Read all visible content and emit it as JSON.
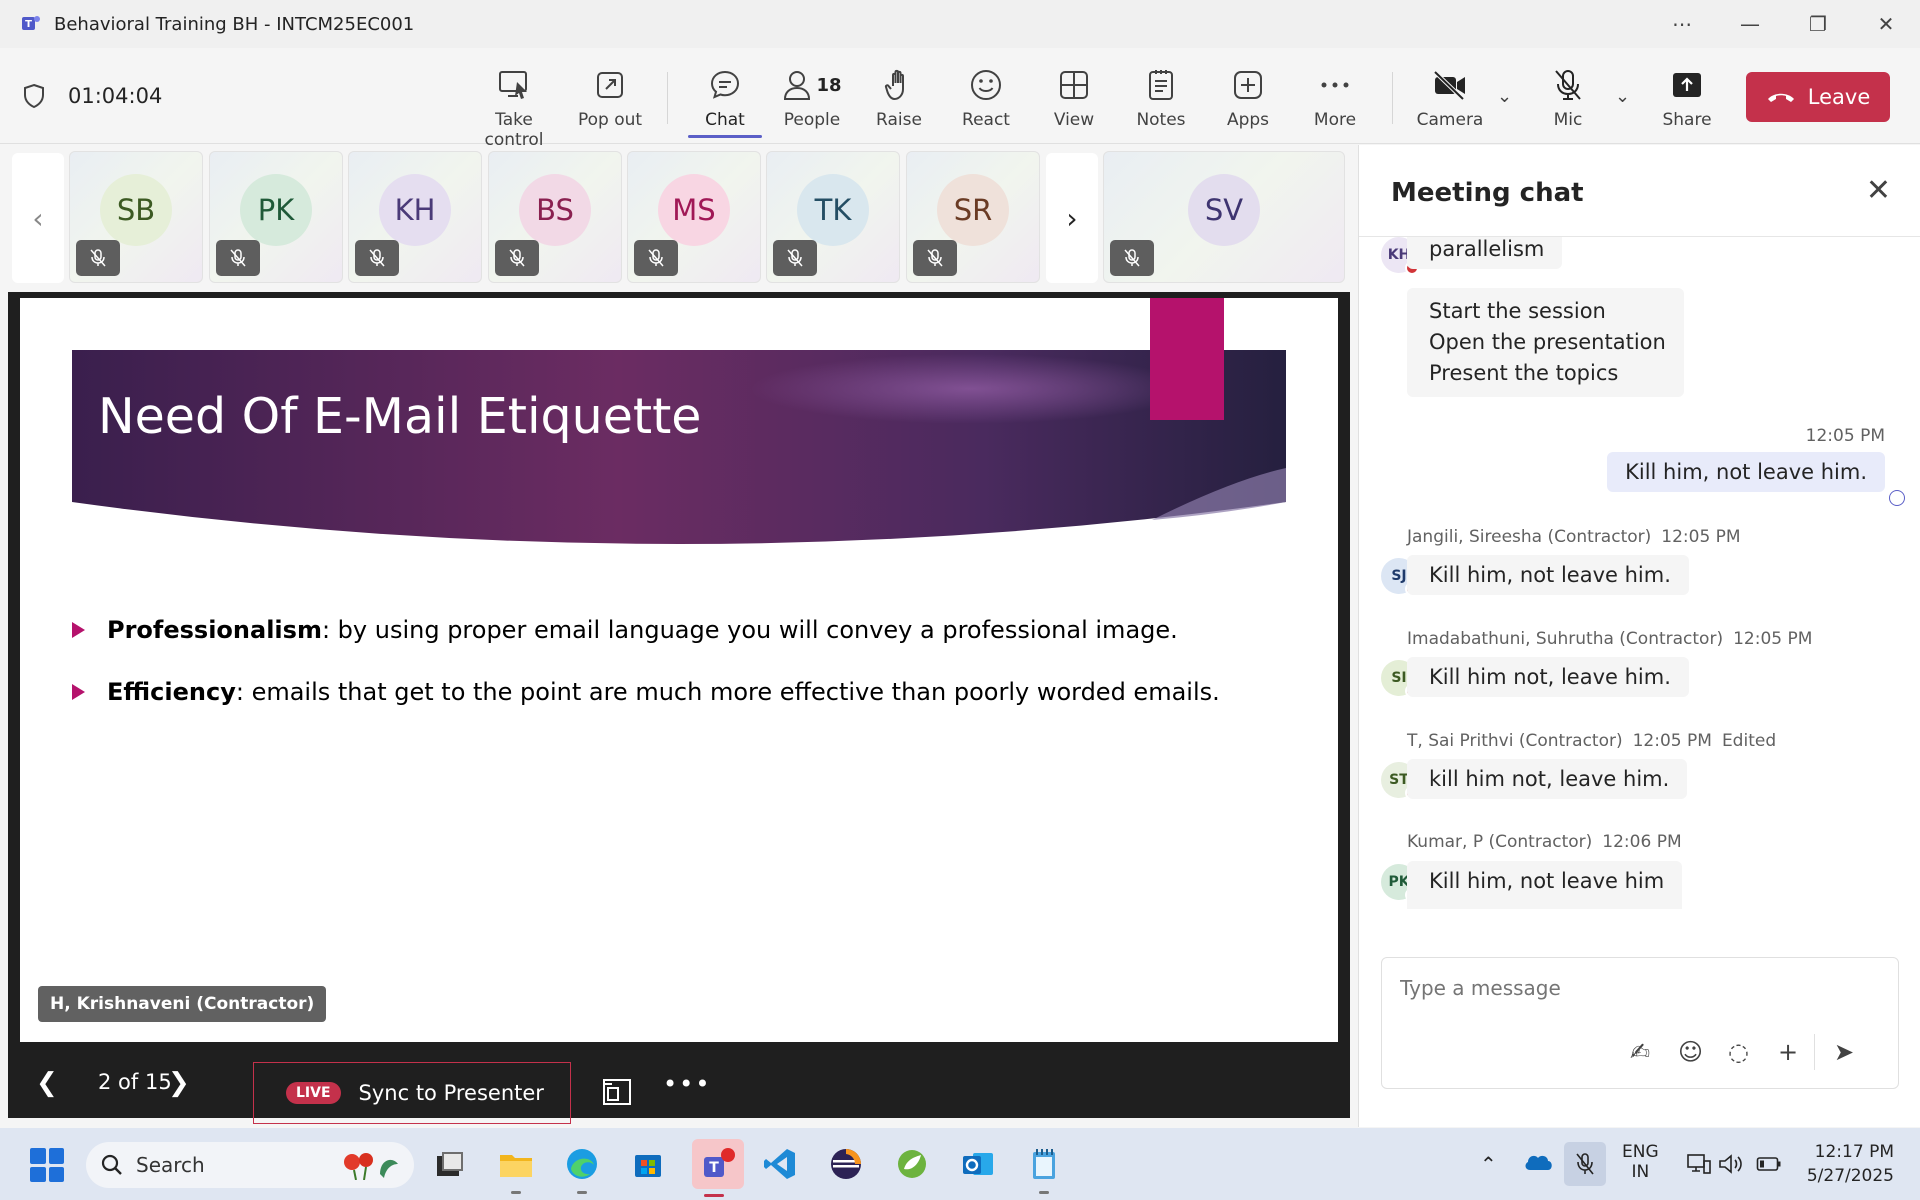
{
  "window": {
    "title": "Behavioral Training BH - INTCM25EC001"
  },
  "toolbar": {
    "timer": "01:04:04",
    "take_control": "Take control",
    "pop_out": "Pop out",
    "chat": "Chat",
    "people": "People",
    "people_count": "18",
    "raise": "Raise",
    "react": "React",
    "view": "View",
    "notes": "Notes",
    "apps": "Apps",
    "more": "More",
    "camera": "Camera",
    "mic": "Mic",
    "share": "Share",
    "leave": "Leave"
  },
  "participants": [
    {
      "initials": "SB",
      "bg": "#e6efd8",
      "fg": "#3c5a22"
    },
    {
      "initials": "PK",
      "bg": "#d6eadc",
      "fg": "#1f5a38"
    },
    {
      "initials": "KH",
      "bg": "#e5def0",
      "fg": "#4a3a78"
    },
    {
      "initials": "BS",
      "bg": "#f2d9e6",
      "fg": "#8a2050"
    },
    {
      "initials": "MS",
      "bg": "#f8d6e3",
      "fg": "#a01856"
    },
    {
      "initials": "TK",
      "bg": "#d9e7ee",
      "fg": "#244e64"
    },
    {
      "initials": "SR",
      "bg": "#efe1da",
      "fg": "#6a3b24"
    },
    {
      "initials": "SV",
      "bg": "#e3ddee",
      "fg": "#3e3470"
    }
  ],
  "slide": {
    "title": "Need Of E-Mail Etiquette",
    "bullets": [
      {
        "term": "Professionalism",
        "text": ": by using proper email language you will convey a professional image."
      },
      {
        "term": "Efficiency",
        "text": ": emails that get to the point are much more effective than poorly worded emails."
      }
    ],
    "presenter": "H, Krishnaveni (Contractor)",
    "page": "2 of 15",
    "live": "LIVE",
    "sync": "Sync to Presenter"
  },
  "chat": {
    "title": "Meeting chat",
    "messages": {
      "kh": {
        "initials": "KH",
        "text": "parallelism"
      },
      "kh_list": [
        "Start the session",
        "Open the presentation",
        "Present the topics"
      ],
      "mine_time": "12:05 PM",
      "mine_text": "Kill him, not leave him.",
      "sj": {
        "initials": "SJ",
        "name": "Jangili, Sireesha (Contractor)",
        "time": "12:05 PM",
        "text": "Kill him, not leave him."
      },
      "si": {
        "initials": "SI",
        "name": "Imadabathuni, Suhrutha (Contractor)",
        "time": "12:05 PM",
        "text": "Kill him not, leave him."
      },
      "st": {
        "initials": "ST",
        "name": "T, Sai Prithvi (Contractor)",
        "time": "12:05 PM",
        "edited": "Edited",
        "text": "kill him not, leave him."
      },
      "pk": {
        "initials": "PK",
        "name": "Kumar, P (Contractor)",
        "time": "12:06 PM",
        "text": "Kill him, not leave him"
      }
    },
    "composer_placeholder": "Type a message"
  },
  "taskbar": {
    "search": "Search",
    "lang_top": "ENG",
    "lang_bottom": "IN",
    "time": "12:17 PM",
    "date": "5/27/2025"
  },
  "colors": {
    "accent": "#5b5fc7",
    "leave": "#c4314b",
    "slide_accent": "#b5126c"
  }
}
